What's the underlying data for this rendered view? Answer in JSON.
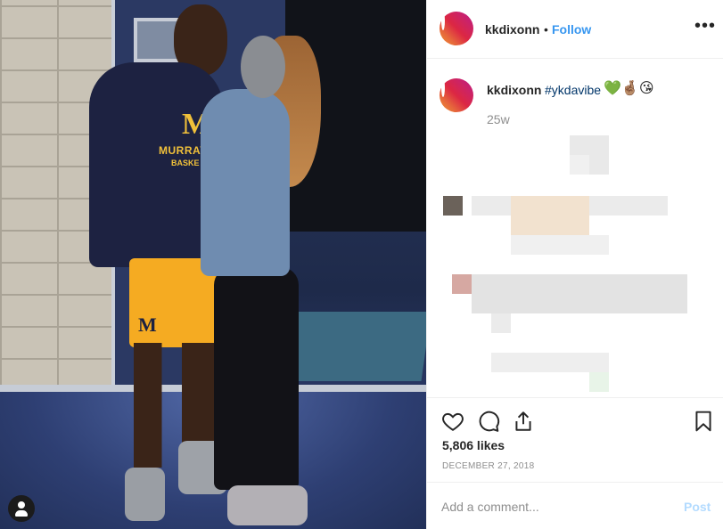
{
  "post": {
    "username": "kkdixonn",
    "separator": "•",
    "follow_label": "Follow",
    "more_label": "•••"
  },
  "caption": {
    "username": "kkdixonn",
    "hashtag": "#ykdavibe",
    "emojis": "💚🤞🏽😘",
    "age": "25w"
  },
  "photo": {
    "shirt_text": "MURRAY",
    "shirt_text2": "BASKE",
    "logo_letter": "M",
    "shorts_letter": "M"
  },
  "engagement": {
    "likes": "5,806 likes",
    "date": "DECEMBER 27, 2018"
  },
  "comment_box": {
    "placeholder": "Add a comment...",
    "post_label": "Post"
  },
  "icons": {
    "like": "heart-icon",
    "comment": "comment-bubble-icon",
    "share": "share-icon",
    "save": "bookmark-icon",
    "more": "more-options-icon",
    "profile": "user-icon"
  },
  "colors": {
    "follow": "#3897f0",
    "hashtag": "#003569",
    "post_disabled": "#b3dbff",
    "avatar_ring": "#dc2743"
  }
}
